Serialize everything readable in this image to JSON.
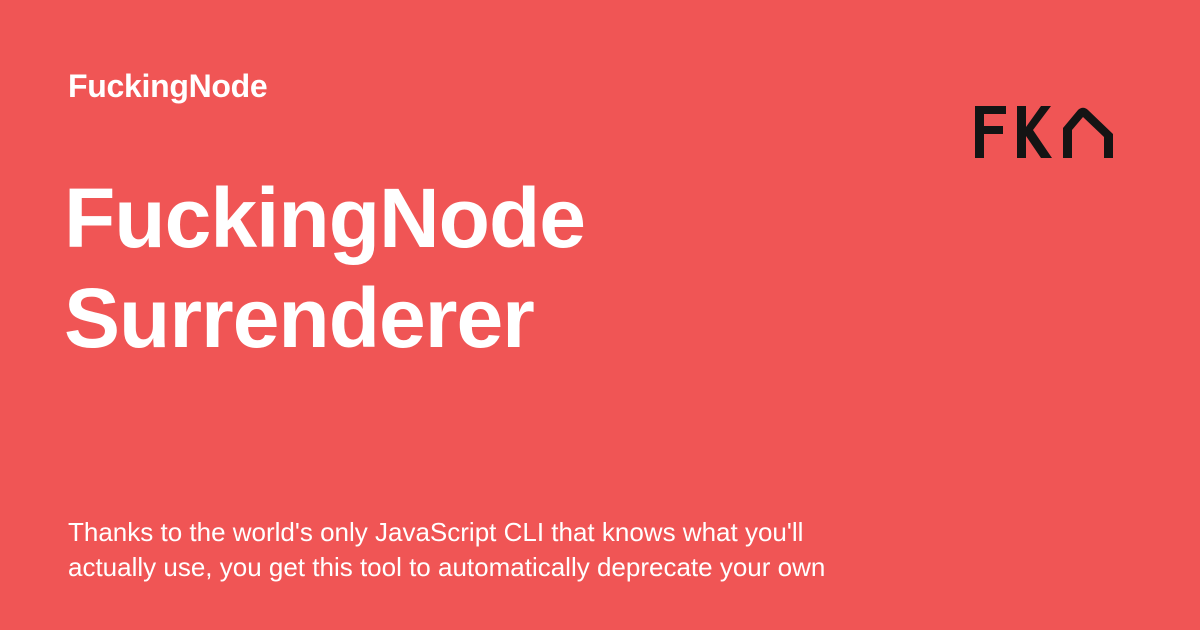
{
  "header": {
    "site_name": "FuckingNode"
  },
  "logo": {
    "text": "FKN",
    "color": "#141414"
  },
  "main": {
    "title_lines": [
      "FuckingNode",
      "Surrenderer"
    ],
    "description_lines": [
      "Thanks to the world's only JavaScript CLI that knows what you'll",
      "actually use, you get this tool to automatically deprecate your own"
    ]
  },
  "colors": {
    "background": "#f05555",
    "text": "#ffffff"
  }
}
